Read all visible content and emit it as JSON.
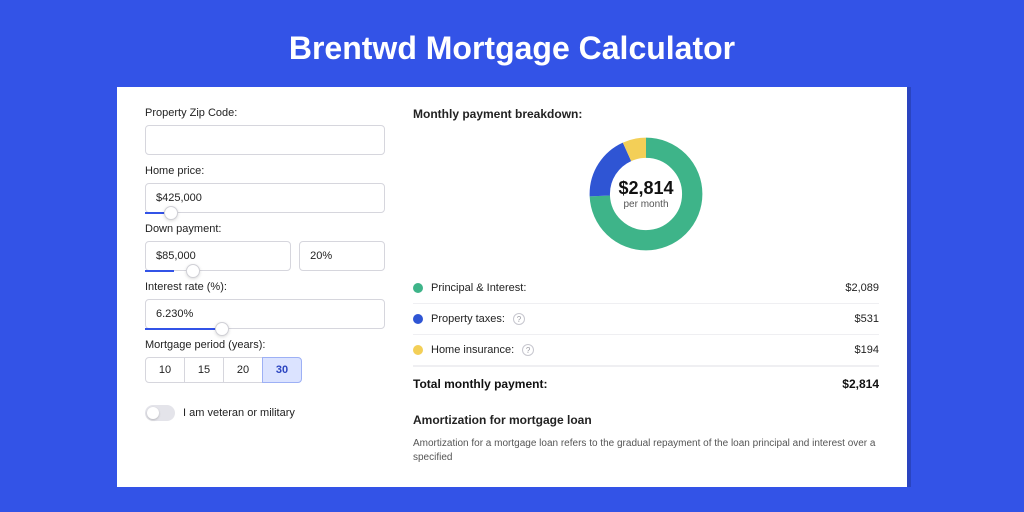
{
  "title": "Brentwd Mortgage Calculator",
  "form": {
    "zip_label": "Property Zip Code:",
    "zip_value": "",
    "home_price_label": "Home price:",
    "home_price_value": "$425,000",
    "down_payment_label": "Down payment:",
    "down_payment_value": "$85,000",
    "down_payment_pct": "20%",
    "interest_label": "Interest rate (%):",
    "interest_value": "6.230%",
    "period_label": "Mortgage period (years):",
    "period_options": [
      "10",
      "15",
      "20",
      "30"
    ],
    "period_selected": "30",
    "veteran_label": "I am veteran or military"
  },
  "breakdown": {
    "title": "Monthly payment breakdown:",
    "center_amount": "$2,814",
    "center_sub": "per month",
    "items": [
      {
        "label": "Principal & Interest:",
        "value": "$2,089",
        "color": "g",
        "info": false
      },
      {
        "label": "Property taxes:",
        "value": "$531",
        "color": "b",
        "info": true
      },
      {
        "label": "Home insurance:",
        "value": "$194",
        "color": "y",
        "info": true
      }
    ],
    "total_label": "Total monthly payment:",
    "total_value": "$2,814"
  },
  "amort": {
    "title": "Amortization for mortgage loan",
    "text": "Amortization for a mortgage loan refers to the gradual repayment of the loan principal and interest over a specified"
  },
  "chart_data": {
    "type": "pie",
    "title": "Monthly payment breakdown",
    "series": [
      {
        "name": "Principal & Interest",
        "value": 2089,
        "color": "#3eb489"
      },
      {
        "name": "Property taxes",
        "value": 531,
        "color": "#2f55d4"
      },
      {
        "name": "Home insurance",
        "value": 194,
        "color": "#f3cf57"
      }
    ],
    "total": 2814
  }
}
